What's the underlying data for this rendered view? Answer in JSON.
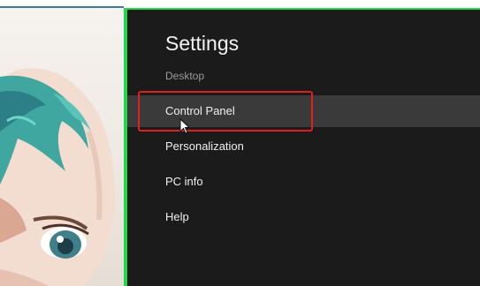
{
  "settings_panel": {
    "title": "Settings",
    "subtitle": "Desktop",
    "items": [
      {
        "label": "Control Panel"
      },
      {
        "label": "Personalization"
      },
      {
        "label": "PC info"
      },
      {
        "label": "Help"
      }
    ]
  },
  "colors": {
    "panel_background": "#1b1b1b",
    "hover_background": "#3a3a3a",
    "highlight_border": "#e02020",
    "panel_edge": "#22d84a",
    "hair": "#3fa7a0"
  },
  "icons": {
    "cursor": "mouse-pointer-icon"
  }
}
